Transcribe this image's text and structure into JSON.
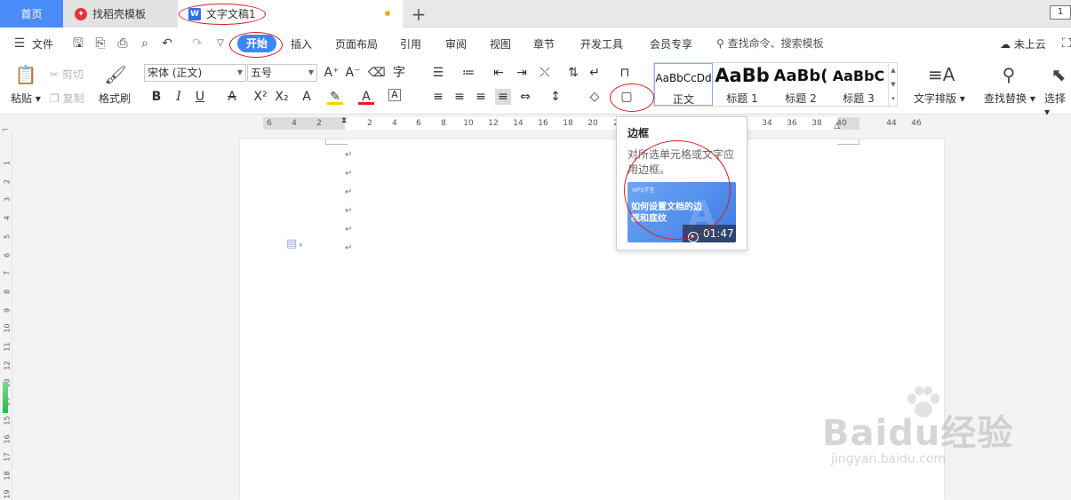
{
  "tabs": {
    "home": "首页",
    "template": "找稻壳模板",
    "document": "文字文稿1",
    "add": "+",
    "window_ctl": "1"
  },
  "menu": {
    "file": "文件",
    "items": [
      "开始",
      "插入",
      "页面布局",
      "引用",
      "审阅",
      "视图",
      "章节",
      "开发工具",
      "会员专享"
    ],
    "search_placeholder": "查找命令、搜索模板",
    "cloud": "未上云"
  },
  "ribbon": {
    "paste": "粘贴",
    "cut": "剪切",
    "copy": "复制",
    "format_painter": "格式刷",
    "font_name": "宋体 (正文)",
    "font_size": "五号",
    "styles": [
      {
        "sample": "AaBbCcDd",
        "label": "正文"
      },
      {
        "sample": "AaBb",
        "label": "标题 1"
      },
      {
        "sample": "AaBb(",
        "label": "标题 2"
      },
      {
        "sample": "AaBbC",
        "label": "标题 3"
      }
    ],
    "text_layout": "文字排版",
    "find_replace": "查找替换",
    "select": "选择"
  },
  "ruler": {
    "h_numbers": [
      "6",
      "4",
      "2",
      "2",
      "4",
      "6",
      "8",
      "10",
      "12",
      "14",
      "16",
      "18",
      "20",
      "22",
      "34",
      "36",
      "38",
      "40",
      "44",
      "46"
    ],
    "v_numbers": [
      "1",
      "2",
      "3",
      "4",
      "5",
      "6",
      "7",
      "8",
      "9",
      "10",
      "11",
      "12",
      "13",
      "14",
      "15",
      "16",
      "17",
      "18",
      "19"
    ]
  },
  "tooltip": {
    "title": "边框",
    "description": "对所选单元格或文字应用边框。",
    "thumb_small": "WPS学堂",
    "thumb_title": "如何设置文档的边框和底纹",
    "duration": "01:47"
  },
  "watermark": {
    "main": "Baidu经验",
    "sub": "jingyan.baidu.com"
  }
}
